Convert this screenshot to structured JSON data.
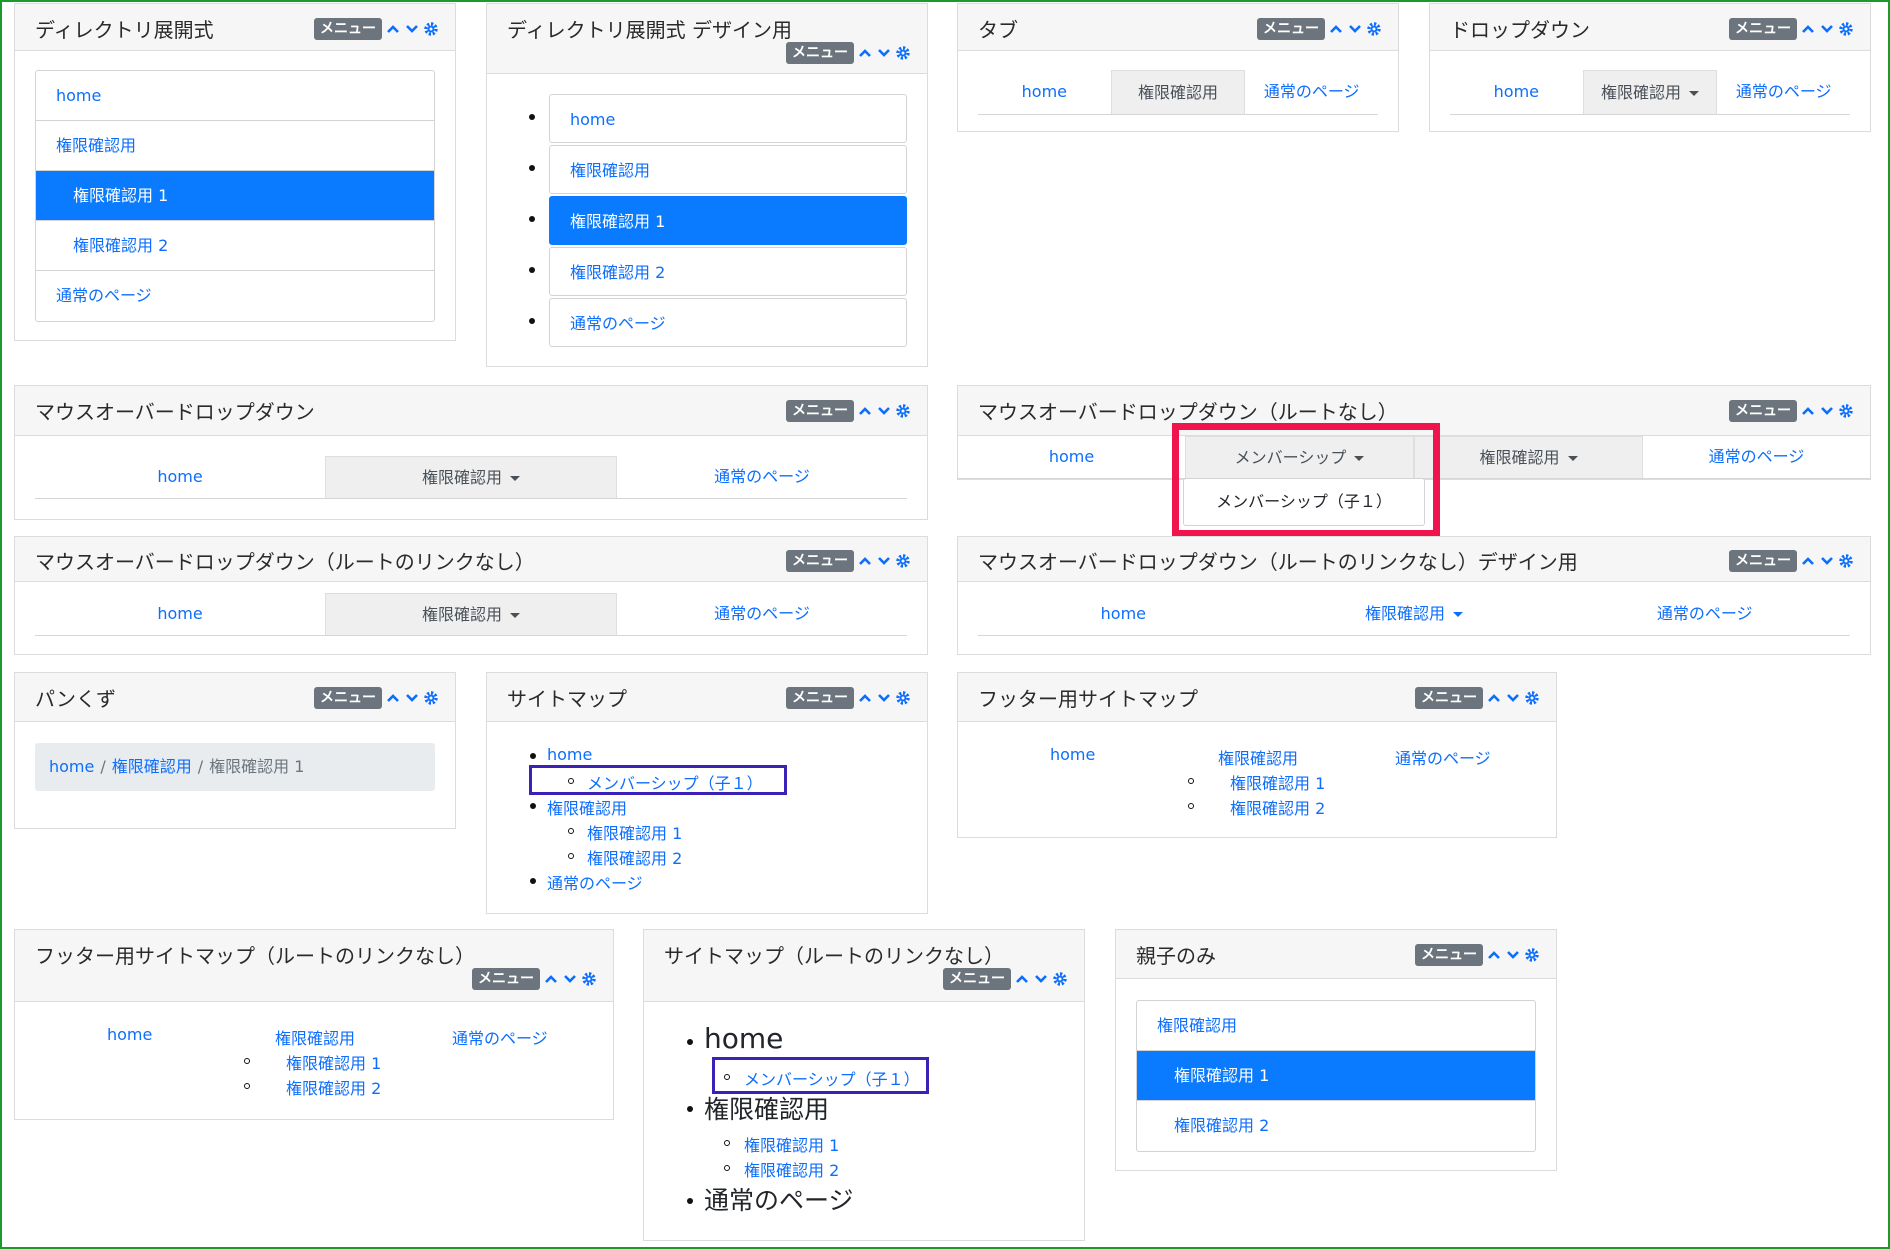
{
  "menu_badge": "メニュー",
  "items": {
    "home": "home",
    "auth": "権限確認用",
    "auth1": "権限確認用 1",
    "auth2": "権限確認用 2",
    "normal": "通常のページ",
    "member": "メンバーシップ",
    "member_child": "メンバーシップ（子１）"
  },
  "panels": {
    "dir_expand": {
      "title": "ディレクトリ展開式"
    },
    "dir_expand_design": {
      "title": "ディレクトリ展開式 デザイン用"
    },
    "tab": {
      "title": "タブ"
    },
    "dropdown": {
      "title": "ドロップダウン"
    },
    "mouseover": {
      "title": "マウスオーバードロップダウン"
    },
    "mouseover_noroot": {
      "title": "マウスオーバードロップダウン（ルートなし）"
    },
    "mouseover_nolink": {
      "title": "マウスオーバードロップダウン（ルートのリンクなし）"
    },
    "mouseover_nolink_design": {
      "title": "マウスオーバードロップダウン（ルートのリンクなし）デザイン用"
    },
    "breadcrumb": {
      "title": "パンくず"
    },
    "sitemap": {
      "title": "サイトマップ"
    },
    "footer_sitemap": {
      "title": "フッター用サイトマップ"
    },
    "footer_sitemap_nolink": {
      "title": "フッター用サイトマップ（ルートのリンクなし）"
    },
    "sitemap_nolink": {
      "title": "サイトマップ（ルートのリンクなし）"
    },
    "parent_child": {
      "title": "親子のみ"
    }
  },
  "colors": {
    "link": "#0d6efd",
    "active": "#0a7bff",
    "badge": "#6c757d",
    "highlight_red": "#f0144e",
    "highlight_purple": "#3a22b8",
    "frame": "#1a9a2a"
  },
  "icons": [
    "chevron-up-icon",
    "chevron-down-icon",
    "gear-icon"
  ]
}
